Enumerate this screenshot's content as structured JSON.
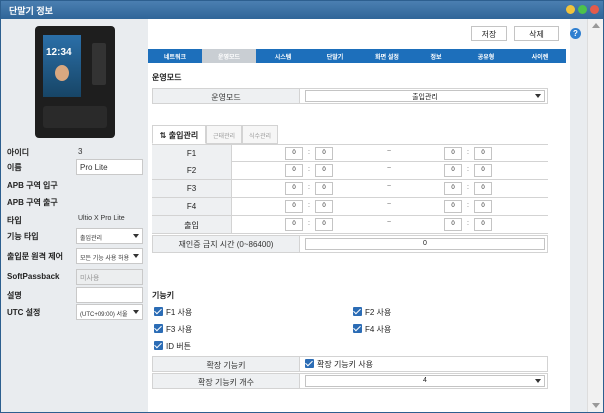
{
  "window": {
    "title": "단말기 정보"
  },
  "device_info": {
    "id_label": "아이디",
    "id_value": "3",
    "name_label": "이름",
    "name_value": "Pro Lite",
    "apb_in_label": "APB 구역 입구",
    "apb_out_label": "APB 구역 출구",
    "type_label": "타입",
    "type_value": "Ultio X Pro Lite",
    "func_type_label": "기능 타입",
    "func_type_value": "출입관리",
    "remote_label": "출입문 원격 제어",
    "remote_value": "모든 기능 사용 허용",
    "softpass_label": "SoftPassback",
    "softpass_value": "미사용",
    "desc_label": "설명",
    "desc_value": "",
    "utc_label": "UTC 설정",
    "utc_value": "(UTC+09:00) 서울"
  },
  "preview": {
    "time": "12:34"
  },
  "toolbar": {
    "save": "저장",
    "delete": "삭제",
    "help": "?"
  },
  "tabs": [
    "네트워크",
    "운영모드",
    "시스템",
    "단말기",
    "화면 설정",
    "정보",
    "공유형",
    "사이렌"
  ],
  "op_mode": {
    "section_title": "운영모드",
    "mode_label": "운영모드",
    "mode_value": "출입관리"
  },
  "subtabs": [
    "출입관리",
    "근태관리",
    "식수관리"
  ],
  "time_rows": [
    {
      "label": "F1",
      "h1": "0",
      "m1": "0",
      "h2": "0",
      "m2": "0"
    },
    {
      "label": "F2",
      "h1": "0",
      "m1": "0",
      "h2": "0",
      "m2": "0"
    },
    {
      "label": "F3",
      "h1": "0",
      "m1": "0",
      "h2": "0",
      "m2": "0"
    },
    {
      "label": "F4",
      "h1": "0",
      "m1": "0",
      "h2": "0",
      "m2": "0"
    },
    {
      "label": "출입",
      "h1": "0",
      "m1": "0",
      "h2": "0",
      "m2": "0"
    }
  ],
  "reauth": {
    "label": "재인증 금지 시간 (0~86400)",
    "value": "0"
  },
  "function_keys": {
    "section_title": "기능키",
    "f1": "F1 사용",
    "f2": "F2 사용",
    "f3": "F3 사용",
    "f4": "F4 사용",
    "id_button": "ID 버튼",
    "ext_label": "확장 기능키",
    "ext_check": "확장 기능키 사용",
    "ext_count_label": "확장 기능키 개수",
    "ext_count_value": "4"
  },
  "colors": {
    "accent": "#1d6fbb",
    "checkbox": "#2b6cb5",
    "titlebar": "#3a70a4"
  }
}
